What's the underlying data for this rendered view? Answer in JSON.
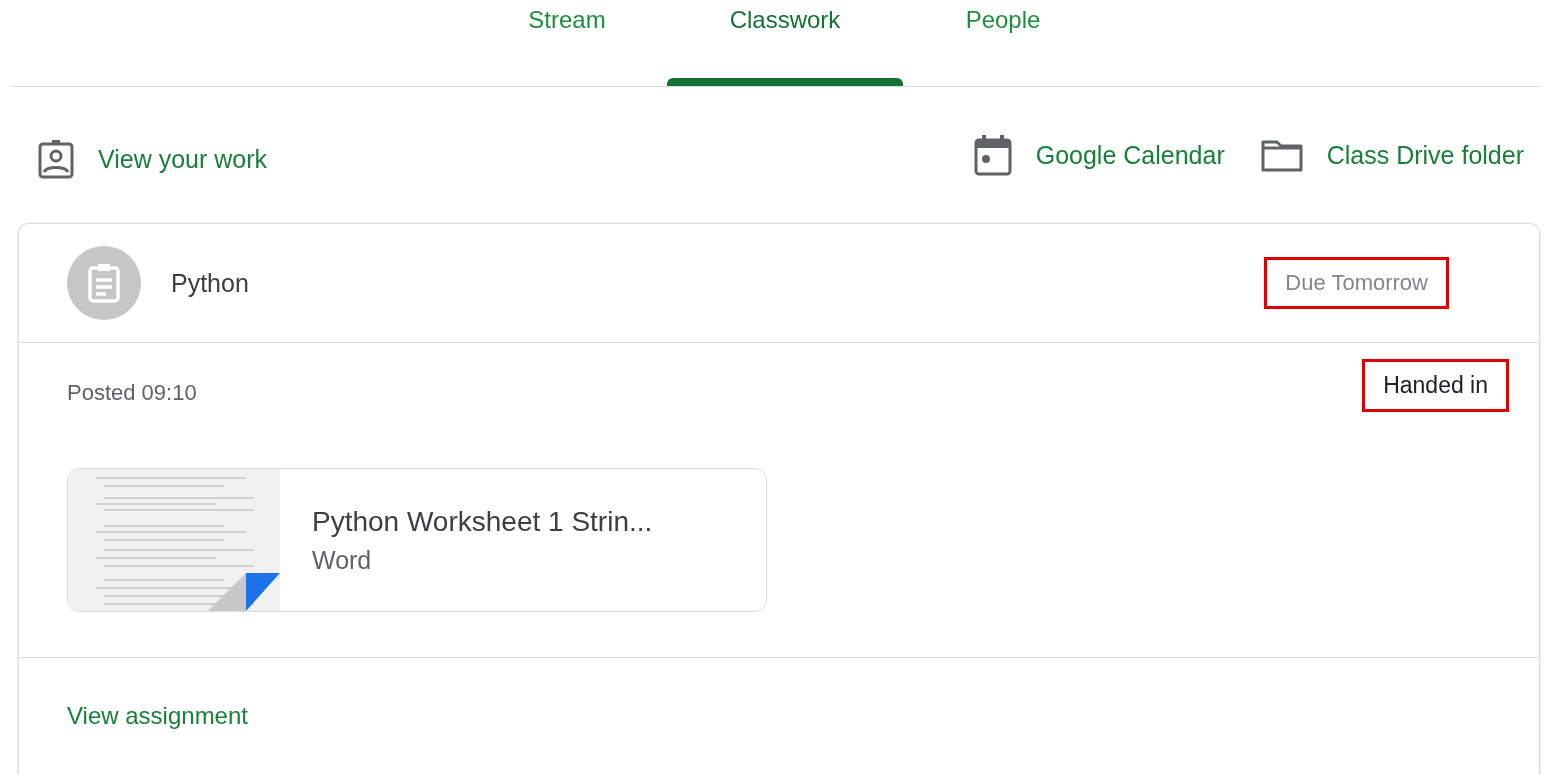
{
  "tabs": [
    {
      "label": "Stream",
      "selected": false
    },
    {
      "label": "Classwork",
      "selected": true
    },
    {
      "label": "People",
      "selected": false
    }
  ],
  "actions": [
    {
      "kind": "work",
      "label": "View your work"
    },
    {
      "kind": "calendar",
      "label": "Google Calendar"
    },
    {
      "kind": "folder",
      "label": "Class Drive folder"
    }
  ],
  "assignment": {
    "title": "Python",
    "due": {
      "text": "Due Tomorrow",
      "highlighted": true
    },
    "posted": "Posted 09:10",
    "status": {
      "text": "Handed in",
      "highlighted": true
    },
    "attachment": {
      "title": "Python Worksheet 1 Strin...",
      "type": "Word"
    },
    "link": "View assignment"
  }
}
